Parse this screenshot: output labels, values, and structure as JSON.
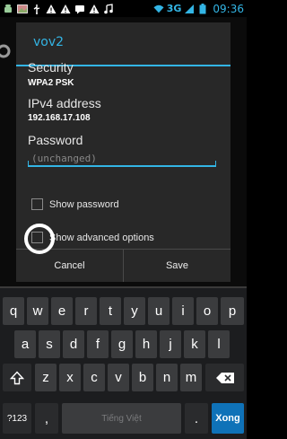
{
  "status_bar": {
    "left_icons": [
      "android-icon",
      "picture-icon",
      "usb-icon",
      "warning-icon",
      "warning-icon",
      "sms-icon",
      "warning-icon",
      "music-icon"
    ],
    "network": "3G",
    "time": "09:36",
    "accent": "#33b5e5"
  },
  "dialog": {
    "title": "vov2",
    "security_label": "Security",
    "security_value": "WPA2 PSK",
    "ip_label": "IPv4 address",
    "ip_value": "192.168.17.108",
    "password_label": "Password",
    "password_placeholder": "(unchanged)",
    "show_password_label": "Show password",
    "show_advanced_label": "Show advanced options",
    "cancel_label": "Cancel",
    "save_label": "Save"
  },
  "keyboard": {
    "row1": [
      "q",
      "w",
      "e",
      "r",
      "t",
      "y",
      "u",
      "i",
      "o",
      "p"
    ],
    "row2": [
      "a",
      "s",
      "d",
      "f",
      "g",
      "h",
      "j",
      "k",
      "l"
    ],
    "row3": [
      "z",
      "x",
      "c",
      "v",
      "b",
      "n",
      "m"
    ],
    "symbols_label": "?123",
    "comma_label": ",",
    "space_label": "Tiếng Việt",
    "period_label": ".",
    "enter_label": "Xong",
    "shift_icon": "shift-icon",
    "backspace_icon": "backspace-icon",
    "enter_color": "#0f72b8"
  }
}
